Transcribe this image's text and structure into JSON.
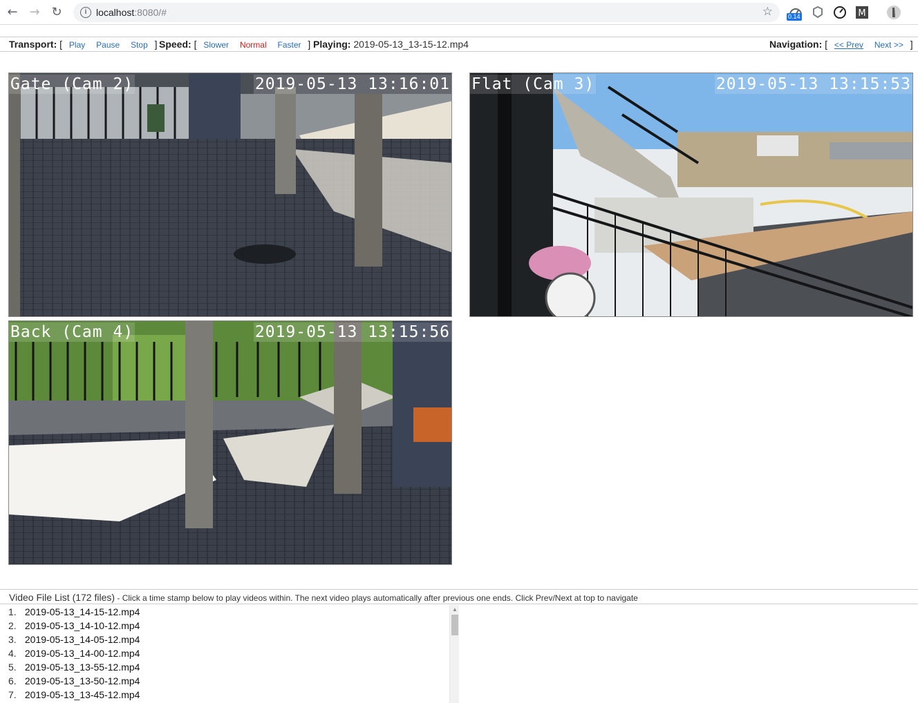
{
  "browser": {
    "url_host": "localhost",
    "url_rest": ":8080/#",
    "ext_badge": "0.14"
  },
  "toolbar": {
    "transport_label": "Transport:",
    "play": "Play",
    "pause": "Pause",
    "stop": "Stop",
    "speed_label": "Speed:",
    "slower": "Slower",
    "normal": "Normal",
    "faster": "Faster",
    "playing_label": "Playing:",
    "playing_file": "2019-05-13_13-15-12.mp4",
    "navigation_label": "Navigation:",
    "prev": "<< Prev",
    "next": "Next >>",
    "open_bracket": "[",
    "close_bracket": "]"
  },
  "cameras": [
    {
      "name": "Gate (Cam 2)",
      "timestamp": "2019-05-13 13:16:01"
    },
    {
      "name": "Flat (Cam 3)",
      "timestamp": "2019-05-13 13:15:53"
    },
    {
      "name": "Back (Cam 4)",
      "timestamp": "2019-05-13 13:15:56"
    }
  ],
  "file_list": {
    "title": "Video File List (172 files)",
    "instructions": " - Click a time stamp below to play videos within. The next video plays automatically after previous one ends. Click Prev/Next at top to navigate",
    "items": [
      {
        "num": "1.",
        "name": "2019-05-13_14-15-12.mp4"
      },
      {
        "num": "2.",
        "name": "2019-05-13_14-10-12.mp4"
      },
      {
        "num": "3.",
        "name": "2019-05-13_14-05-12.mp4"
      },
      {
        "num": "4.",
        "name": "2019-05-13_14-00-12.mp4"
      },
      {
        "num": "5.",
        "name": "2019-05-13_13-55-12.mp4"
      },
      {
        "num": "6.",
        "name": "2019-05-13_13-50-12.mp4"
      },
      {
        "num": "7.",
        "name": "2019-05-13_13-45-12.mp4"
      }
    ]
  }
}
